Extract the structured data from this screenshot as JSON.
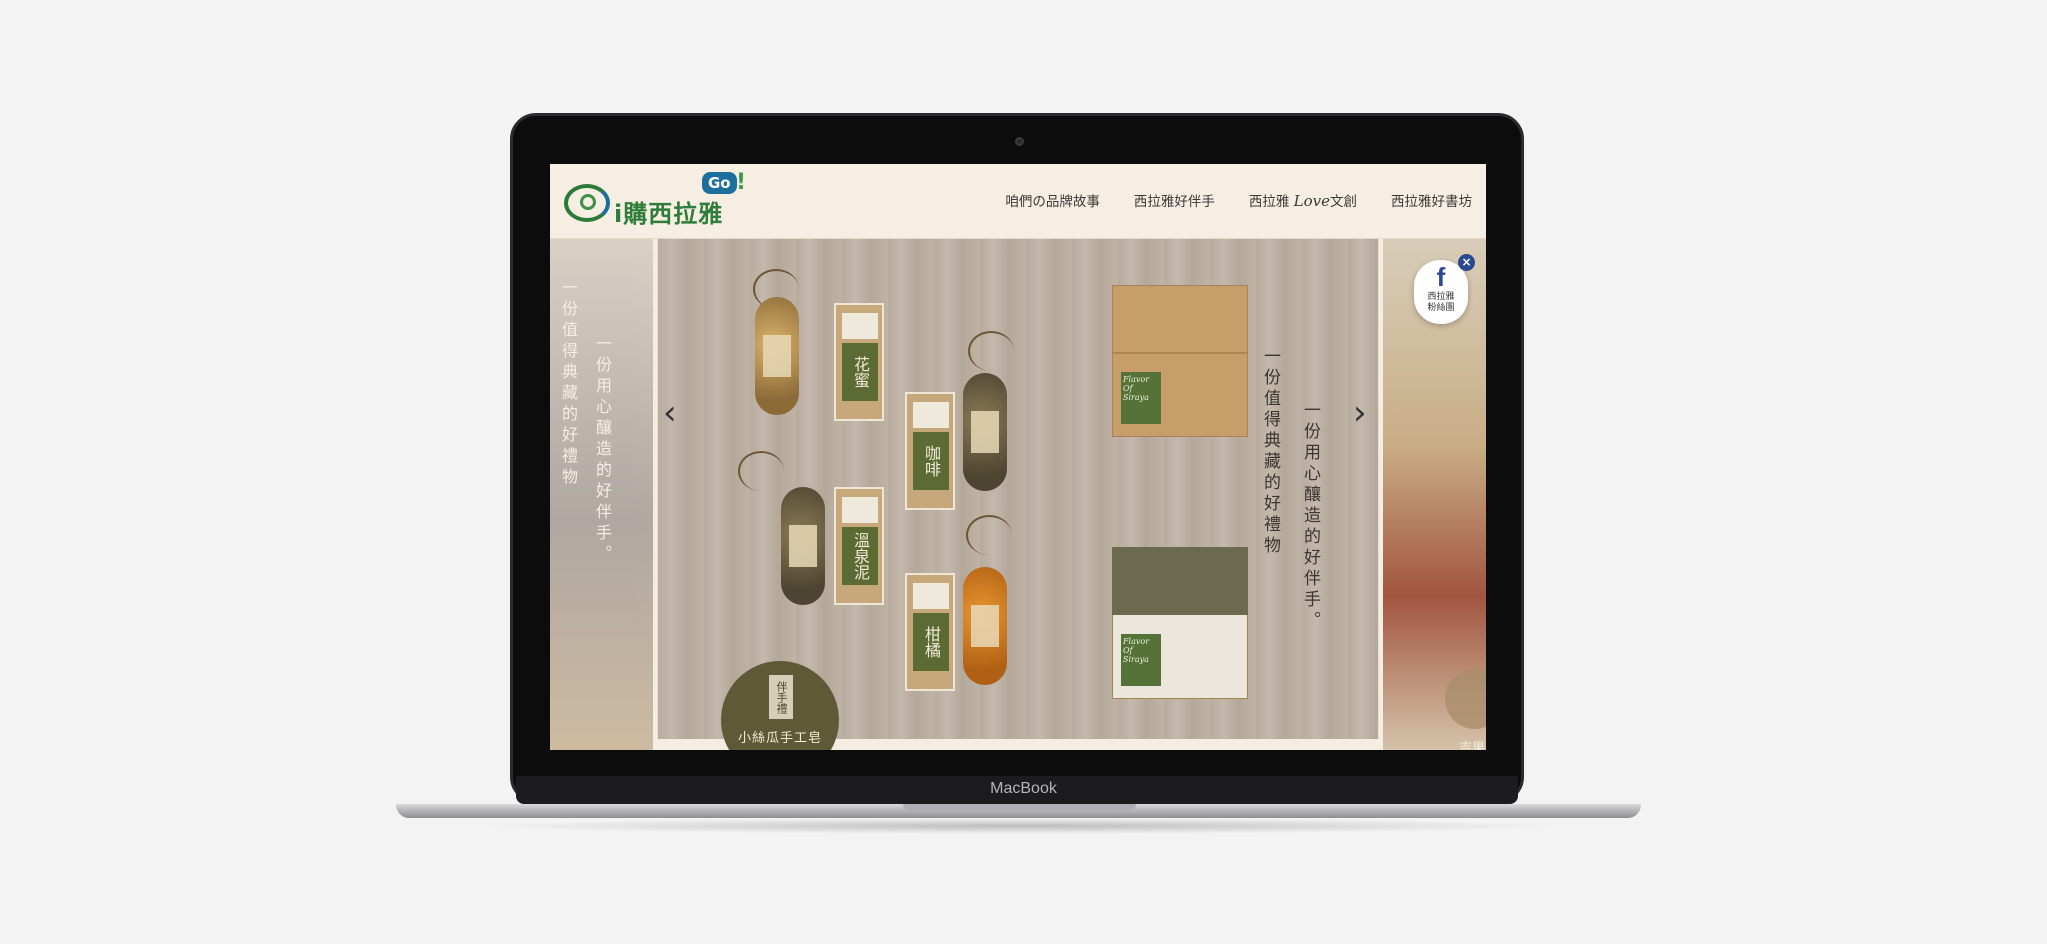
{
  "device": {
    "label": "MacBook"
  },
  "site": {
    "logo": {
      "text": "i購西拉雅",
      "badge": "Go",
      "exclaim": "!"
    },
    "nav": {
      "items": [
        {
          "label": "咱們の品牌故事"
        },
        {
          "label": "西拉雅好伴手"
        },
        {
          "label_prefix": "西拉雅",
          "label_love": "Love",
          "label_suffix": "文創"
        },
        {
          "label": "西拉雅好書坊"
        }
      ]
    },
    "carousel": {
      "prev_icon": "chevron-left-icon",
      "next_icon": "chevron-right-icon",
      "prev_glyph": "‹",
      "next_glyph": "›",
      "slide": {
        "tagline_1": "一份用心釀造的好伴手。",
        "tagline_2": "一份值得典藏的好禮物",
        "soap_labels": [
          "花蜜",
          "咖啡",
          "溫泉泥",
          "柑橘"
        ],
        "box_sticker": "Flavor Of Siraya",
        "badge_seal": "伴手禮",
        "badge_caption": "小絲瓜手工皂"
      },
      "left_preview": {
        "text_1": "一份用心釀造的好伴手。",
        "text_2": "一份值得典藏的好禮物"
      },
      "right_preview": {
        "peek_text": "吉果"
      }
    },
    "facebook_widget": {
      "icon": "facebook-icon",
      "glyph": "f",
      "label_line1": "西拉雅",
      "label_line2": "粉絲團",
      "close": "×"
    }
  },
  "colors": {
    "brand_green": "#2f7d3a",
    "brand_blue": "#1d6f9e",
    "facebook_blue": "#2a4a8f",
    "page_bg": "#f3f3f3"
  }
}
